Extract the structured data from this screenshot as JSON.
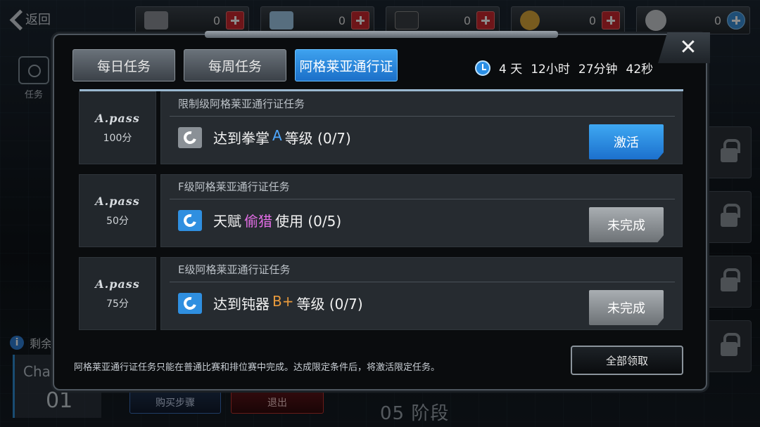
{
  "topbar": {
    "back_label": "返回",
    "resources": [
      {
        "icon": "ticket-icon",
        "count": "0",
        "color": "#8a8f96"
      },
      {
        "icon": "crystal-icon",
        "count": "0",
        "color": "#9fc8e8"
      },
      {
        "icon": "card-pack-icon",
        "count": "0",
        "color": "#3a3f44"
      },
      {
        "icon": "gold-coin-icon",
        "count": "0",
        "color": "#d9a63a"
      },
      {
        "icon": "bp-paw-icon",
        "count": "0",
        "color": "#c8ccd0"
      }
    ]
  },
  "background": {
    "side_label": "任务",
    "remaining_label": "剩余",
    "chapter_text": "Chapt",
    "chapter_num": "01",
    "buy_steps_label": "购买步骤",
    "exit_label": "退出",
    "stage_label": "05 阶段"
  },
  "modal": {
    "tabs": [
      {
        "label": "每日任务",
        "active": false
      },
      {
        "label": "每周任务",
        "active": false
      },
      {
        "label": "阿格莱亚通行证",
        "active": true
      }
    ],
    "timer": {
      "days": "4 天",
      "hours": "12小时",
      "minutes": "27分钟",
      "seconds": "42秒"
    },
    "tasks": [
      {
        "category": "限制级阿格莱亚通行证任务",
        "pass_logo": "A.pass",
        "points": "100分",
        "icon": "refresh-icon",
        "icon_color": "grey",
        "text_before": "达到拳掌",
        "highlight": "A",
        "text_after": "等级 (0/7)",
        "highlight_color": "blue",
        "button_label": "激活",
        "button_state": "activate"
      },
      {
        "category": "F级阿格莱亚通行证任务",
        "pass_logo": "A.pass",
        "points": "50分",
        "icon": "refresh-icon",
        "icon_color": "blue",
        "text_before": "天赋",
        "highlight": "偷猎",
        "text_after": "使用 (0/5)",
        "highlight_color": "pink",
        "button_label": "未完成",
        "button_state": "incomplete"
      },
      {
        "category": "E级阿格莱亚通行证任务",
        "pass_logo": "A.pass",
        "points": "75分",
        "icon": "refresh-icon",
        "icon_color": "blue",
        "text_before": "达到钝器",
        "highlight": "B+",
        "text_after": "等级 (0/7)",
        "highlight_color": "orange",
        "button_label": "未完成",
        "button_state": "incomplete"
      }
    ],
    "footer_note": "阿格莱亚通行证任务只能在普通比赛和排位赛中完成。达成限定条件后，将激活限定任务。",
    "claim_all_label": "全部领取"
  }
}
